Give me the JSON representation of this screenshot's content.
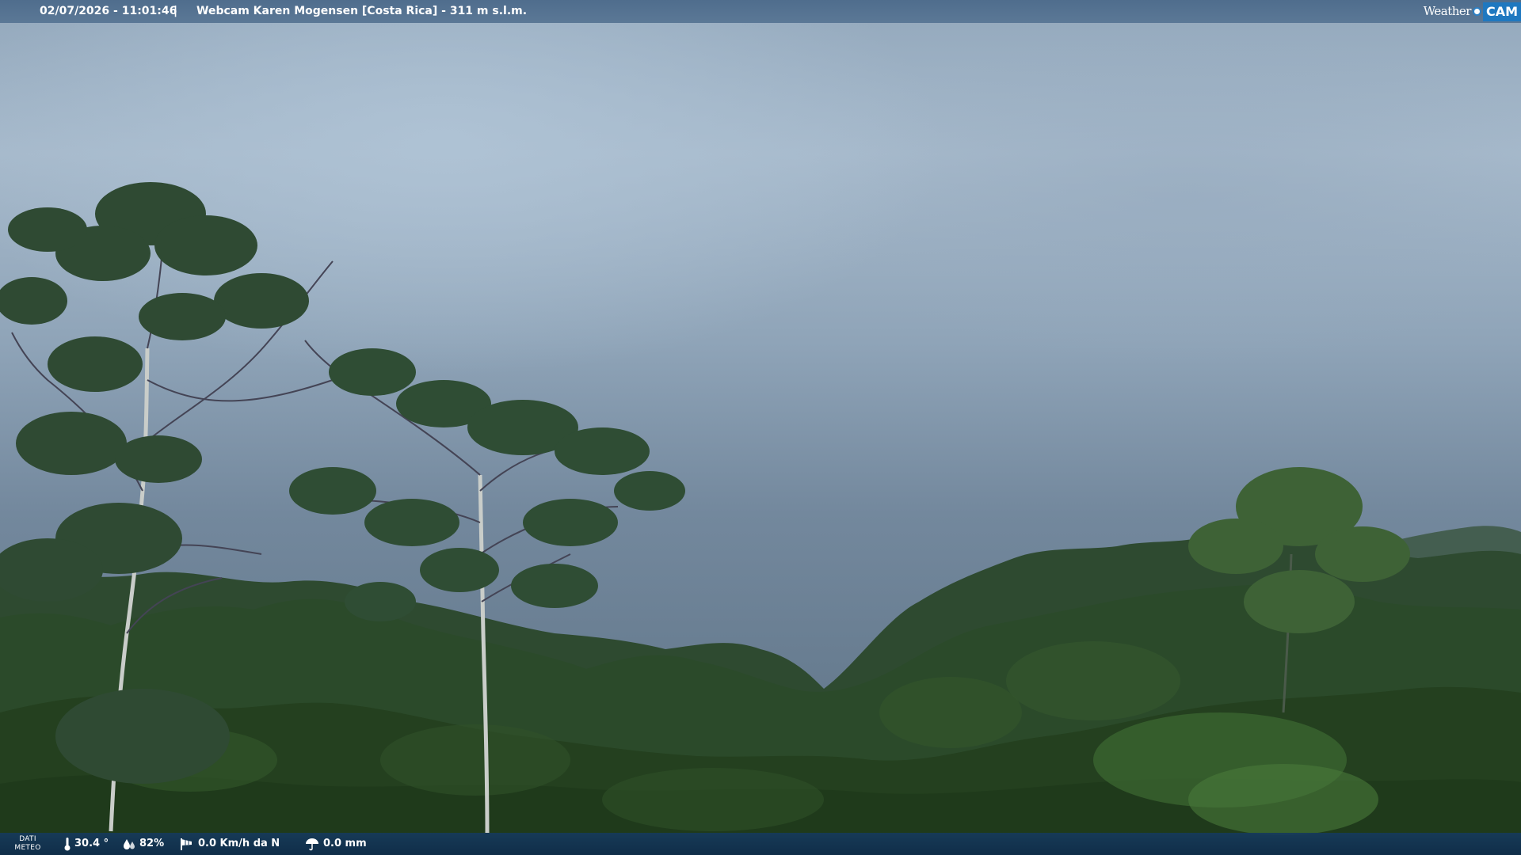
{
  "overlay": {
    "datetime": "02/07/2026 - 11:01:46",
    "separator": "|",
    "title": "Webcam Karen Mogensen [Costa Rica]  - 311 m s.l.m."
  },
  "logo": {
    "weather_text": "Weather",
    "cam_text": "CAM",
    "accent_color": "#1f78c0"
  },
  "weather": {
    "label_line1": "DATI",
    "label_line2": "METEO",
    "temperature": "30.4 °",
    "humidity": "82%",
    "wind": "0.0 Km/h da N",
    "rain": "0.0 mm",
    "icons": [
      "thermometer-icon",
      "humidity-drops-icon",
      "wind-sock-icon",
      "rain-umbrella-icon"
    ]
  }
}
